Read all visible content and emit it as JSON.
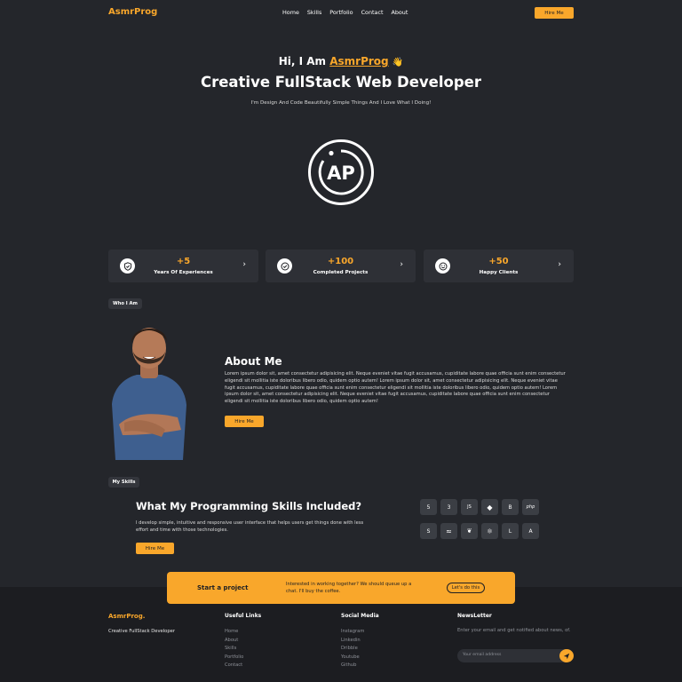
{
  "nav": {
    "logo": "AsmrProg",
    "links": [
      "Home",
      "Skills",
      "Portfolio",
      "Contact",
      "About"
    ],
    "hire_label": "Hire Me"
  },
  "hero": {
    "greeting_prefix": "Hi, I Am ",
    "greeting_name": "AsmrProg",
    "wave": "👋",
    "title": "Creative FullStack Web Developer",
    "subtitle": "I'm Design And Code Beautifully Simple Things And I Love What I Doing!",
    "logo_text": "AP"
  },
  "stats": [
    {
      "value": "+5",
      "label": "Years Of Experiences",
      "icon": "shield-check-icon"
    },
    {
      "value": "+100",
      "label": "Completed Projects",
      "icon": "check-circle-icon"
    },
    {
      "value": "+50",
      "label": "Happy Clients",
      "icon": "smile-icon"
    }
  ],
  "about": {
    "badge": "Who I Am",
    "title": "About Me",
    "text": "Lorem ipsum dolor sit, amet consectetur adipisicing elit. Neque eveniet vitae fugit accusamus, cupiditate labore quae officia sunt enim consectetur eligendi sit mollitia iste doloribus libero odio, quidem optio autem! Lorem ipsum dolor sit, amet consectetur adipisicing elit. Neque eveniet vitae fugit accusamus, cupiditate labore quae officia sunt enim consectetur eligendi sit mollitia iste doloribus libero odio, quidem optio autem! Lorem ipsum dolor sit, amet consectetur adipisicing elit. Neque eveniet vitae fugit accusamus, cupiditate labore quae officia sunt enim consectetur eligendi sit mollitia iste doloribus libero odio, quidem optio autem!",
    "button": "Hire Me"
  },
  "skills": {
    "badge": "My Skills",
    "title": "What My Programming Skills Included?",
    "text": "I develop simple, intuitive and responsive user interface that helps users get things done with less effort and time with those technologies.",
    "button": "Hire Me",
    "icons": [
      "html5-icon",
      "css3-icon",
      "javascript-icon",
      "git-icon",
      "bootstrap-icon",
      "php-icon",
      "sass-icon",
      "tailwind-icon",
      "mongodb-icon",
      "react-icon",
      "laravel-icon",
      "angular-icon"
    ],
    "icon_glyphs": [
      "5",
      "3",
      "JS",
      "◆",
      "B",
      "php",
      "S",
      "≈",
      "❦",
      "⚛",
      "L",
      "A"
    ]
  },
  "cta": {
    "title": "Start a project",
    "text": "Interested in working together? We should queue up a chat. I'll buy the coffee.",
    "button": "Let's do this"
  },
  "footer": {
    "logo": "AsmrProg.",
    "tagline": "Creative FullStack Developer",
    "useful_title": "Useful Links",
    "useful_links": [
      "Home",
      "About",
      "Skills",
      "Portfolio",
      "Contact"
    ],
    "social_title": "Social Media",
    "social_links": [
      "Instagram",
      "Linkedin",
      "Dribble",
      "Youtube",
      "Github"
    ],
    "newsletter_title": "NewsLetter",
    "newsletter_text": "Enter your email and get notified about news, of.",
    "email_placeholder": "Your email address"
  },
  "colors": {
    "accent": "#f9a72b",
    "background": "#24262b",
    "card": "#2e3036",
    "footer": "#1c1d21"
  }
}
